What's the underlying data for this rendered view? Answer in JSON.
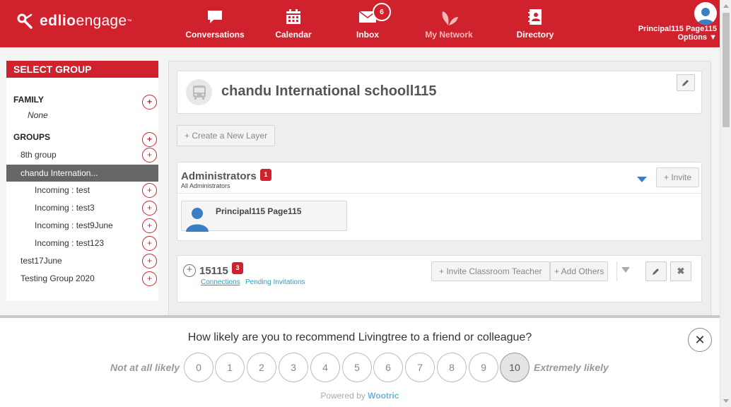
{
  "header": {
    "logo_bold": "edlio",
    "logo_light": "engage",
    "logo_tm": "™",
    "nav": [
      {
        "label": "Conversations",
        "icon": "chat-bubble-icon"
      },
      {
        "label": "Calendar",
        "icon": "calendar-icon"
      },
      {
        "label": "Inbox",
        "icon": "envelope-icon",
        "badge": "6"
      },
      {
        "label": "My Network",
        "icon": "leaf-icon"
      },
      {
        "label": "Directory",
        "icon": "directory-book-icon"
      }
    ],
    "user_name": "Principal115 Page115",
    "options_label": "Options ▼"
  },
  "sidebar": {
    "title": "SELECT GROUP",
    "family_label": "FAMILY",
    "family_value": "None",
    "groups_label": "GROUPS",
    "groups": [
      "8th group",
      "chandu Internation...",
      "Incoming : test",
      "Incoming : test3",
      "Incoming : test9June",
      "Incoming : test123",
      "test17June",
      "Testing Group 2020"
    ],
    "active_index": 1
  },
  "main": {
    "school_name": "chandu International schooll115",
    "create_layer": "+ Create a New Layer",
    "admins": {
      "title": "Administrators",
      "count": "1",
      "subtitle": "All Administrators",
      "invite": "+ Invite",
      "member": "Principal115 Page115"
    },
    "group": {
      "title": "15115",
      "count": "3",
      "link_connections": "Connections",
      "link_pending": "Pending Invitations",
      "invite_teacher": "+ Invite Classroom Teacher",
      "add_others": "+ Add Others"
    }
  },
  "survey": {
    "question": "How likely are you to recommend Livingtree to a friend or colleague?",
    "low_label": "Not at all likely",
    "high_label": "Extremely likely",
    "scores": [
      "0",
      "1",
      "2",
      "3",
      "4",
      "5",
      "6",
      "7",
      "8",
      "9",
      "10"
    ],
    "selected": "10",
    "powered_prefix": "Powered by",
    "powered_brand": "Wootric",
    "close": "✕"
  },
  "colors": {
    "brand_red": "#d0222d",
    "link_blue": "#2a9fc0",
    "avatar_blue": "#3a7fc4"
  }
}
